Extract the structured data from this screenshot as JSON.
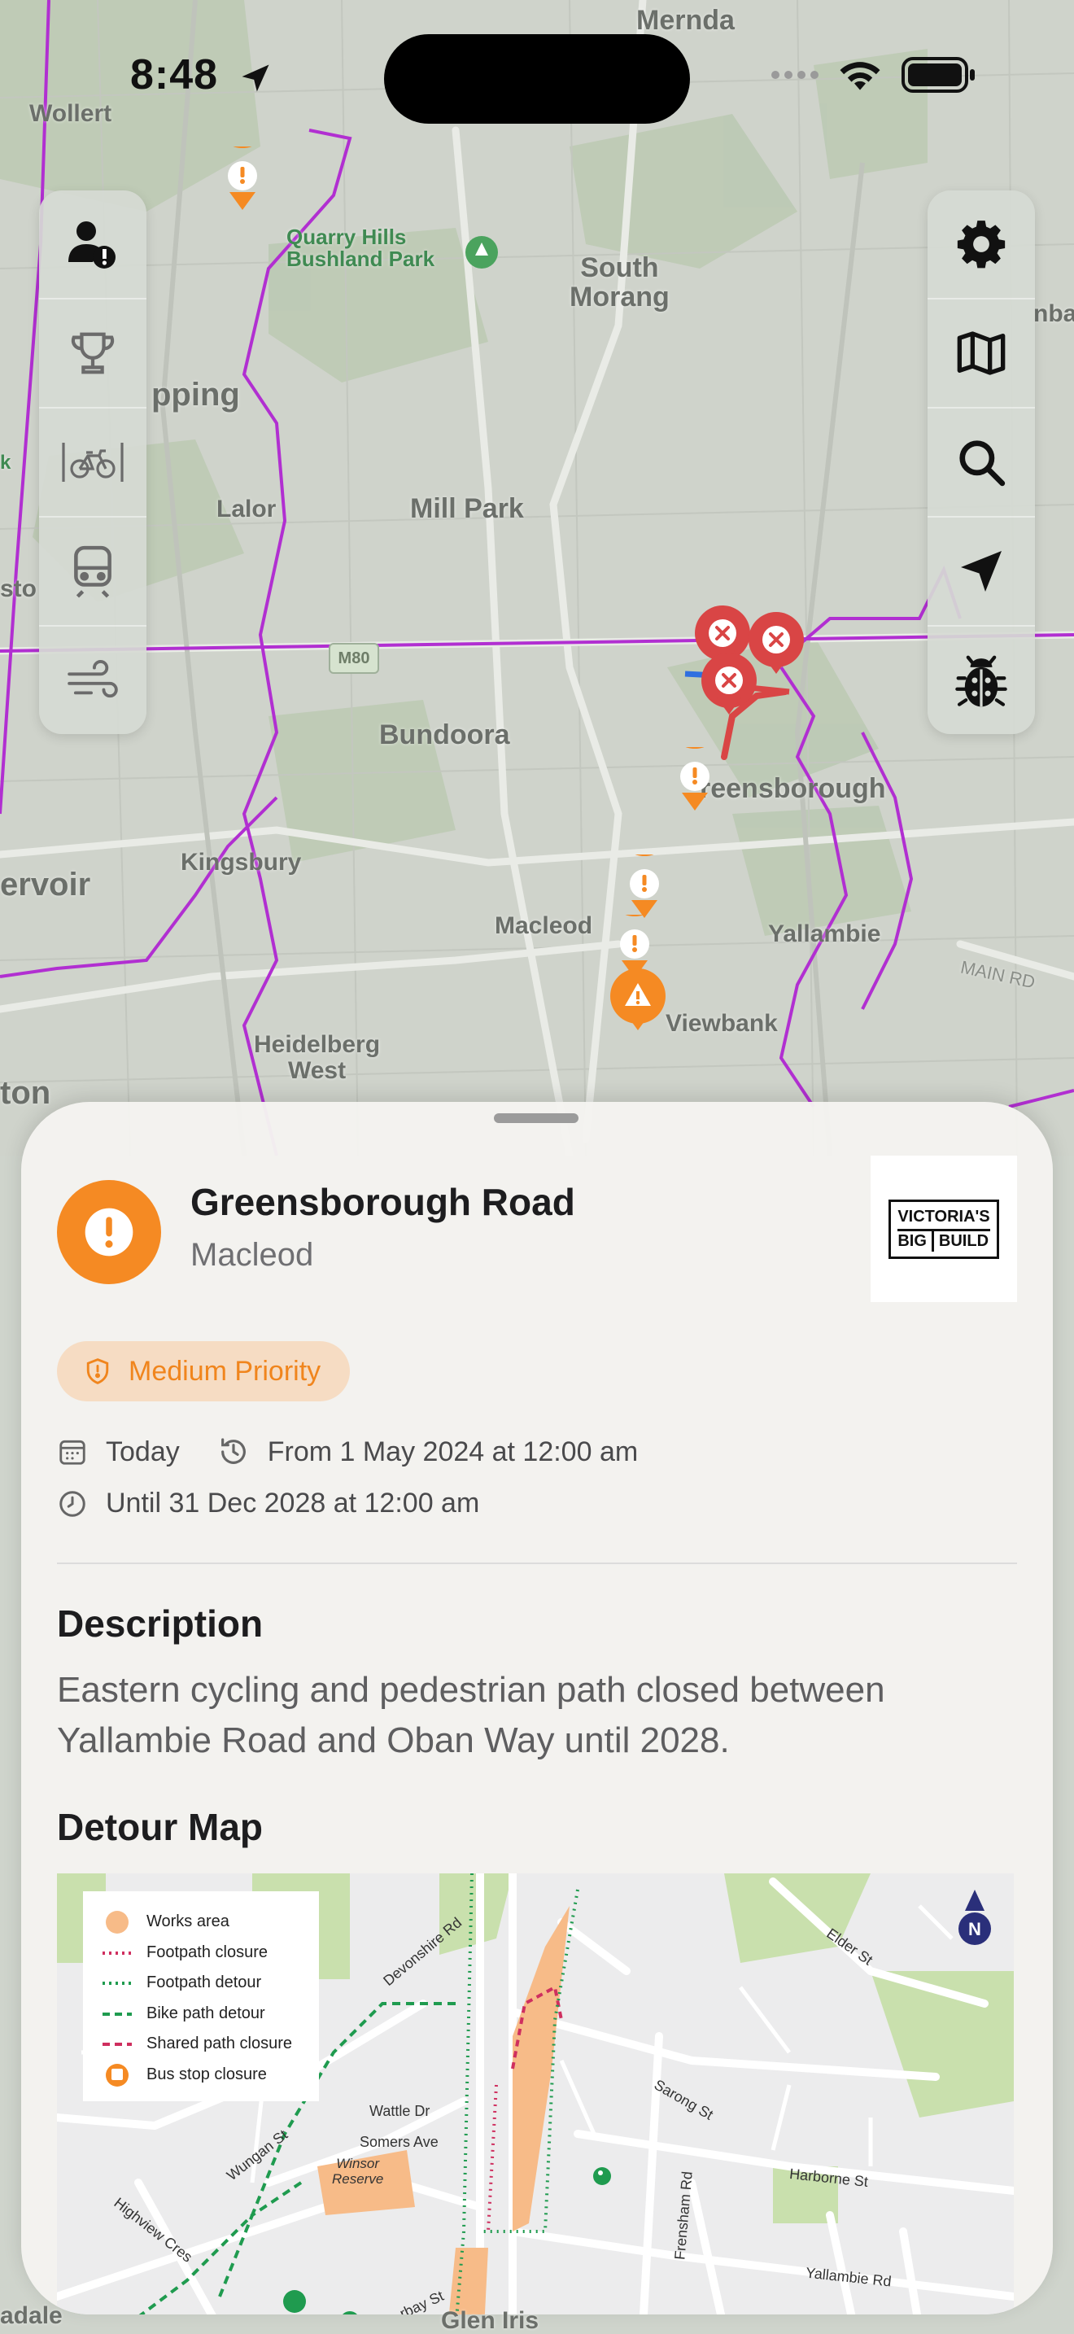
{
  "status_bar": {
    "time": "8:48"
  },
  "map": {
    "labels": {
      "mernda": "Mernda",
      "wollert": "Wollert",
      "quarry_hills": "Quarry Hills\nBushland Park",
      "south_morang": "South\nMorang",
      "epping": "pping",
      "lalor": "Lalor",
      "mill_park": "Mill Park",
      "bundoora": "Bundoora",
      "greensborough": "reensborough",
      "kingsbury": "Kingsbury",
      "reservoir": "ervoir",
      "macleod": "Macleod",
      "yallambie": "Yallambie",
      "viewbank": "Viewbank",
      "heidelberg_west": "Heidelberg\nWest",
      "thornton": "ton",
      "main_rd": "MAIN RD",
      "m80": "M80",
      "sto": "sto",
      "k": "k",
      "nba": "nba"
    }
  },
  "toolbar_left": {
    "items": [
      "person-alert-icon",
      "trophy-icon",
      "bike-icon",
      "train-icon",
      "wind-icon"
    ]
  },
  "toolbar_right": {
    "items": [
      "gear-icon",
      "map-icon",
      "search-icon",
      "location-arrow-icon",
      "bug-icon"
    ]
  },
  "sheet": {
    "title": "Greensborough Road",
    "subtitle": "Macleod",
    "logo_line1": "VICTORIA'S",
    "logo_line2a": "BIG",
    "logo_line2b": "BUILD",
    "priority": "Medium Priority",
    "date_today": "Today",
    "date_from": "From 1 May 2024 at 12:00 am",
    "date_until": "Until 31 Dec 2028 at 12:00 am",
    "description_heading": "Description",
    "description": "Eastern cycling and pedestrian path closed between Yallambie Road and Oban Way until 2028.",
    "detour_heading": "Detour Map",
    "detour_map": {
      "legend": [
        "Works area",
        "Footpath closure",
        "Footpath detour",
        "Bike path detour",
        "Shared path closure",
        "Bus stop closure"
      ],
      "streets": {
        "devonshire": "Devonshire Rd",
        "elder": "Elder St",
        "wattle": "Wattle Dr",
        "somers": "Somers Ave",
        "winsor": "Winsor\nReserve",
        "wungan": "Wungan St",
        "sarong": "Sarong St",
        "frensham": "Frensham Rd",
        "harborne": "Harborne St",
        "yallambie": "Yallambie Rd",
        "highview": "Highview Cres",
        "barbay": "rbay St"
      },
      "north": "N"
    }
  },
  "bottom_labels": {
    "left": "adale",
    "center": "Glen Iris"
  },
  "colors": {
    "accent": "#f58a23",
    "priority_bg": "#f6dcc3",
    "closure_red": "#d94545",
    "purple_route": "#b12fd1"
  }
}
